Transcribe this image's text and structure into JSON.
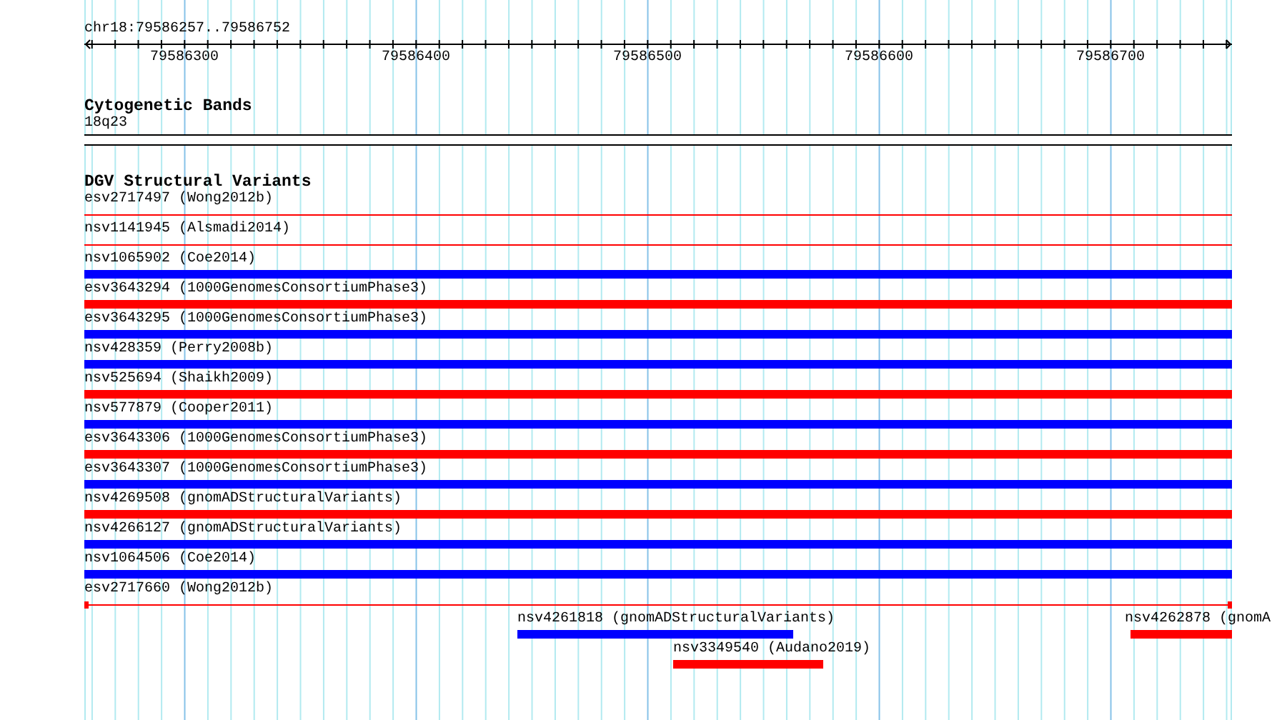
{
  "ruler": {
    "location": "chr18:79586257..79586752",
    "tick_labels": [
      "79586300",
      "79586400",
      "79586500",
      "79586600",
      "79586700"
    ]
  },
  "cytogenetic_bands": {
    "title": "Cytogenetic Bands",
    "band": "18q23"
  },
  "dgv_track": {
    "title": "DGV Structural Variants",
    "features": [
      {
        "label": "esv2717497 (Wong2012b)",
        "color": "#ff0000",
        "kind": "line"
      },
      {
        "label": "nsv1141945 (Alsmadi2014)",
        "color": "#ff0000",
        "kind": "line"
      },
      {
        "label": "nsv1065902 (Coe2014)",
        "color": "#0000ff",
        "kind": "bar"
      },
      {
        "label": "esv3643294 (1000GenomesConsortiumPhase3)",
        "color": "#ff0000",
        "kind": "bar"
      },
      {
        "label": "esv3643295 (1000GenomesConsortiumPhase3)",
        "color": "#0000ff",
        "kind": "bar"
      },
      {
        "label": "nsv428359 (Perry2008b)",
        "color": "#0000ff",
        "kind": "bar"
      },
      {
        "label": "nsv525694 (Shaikh2009)",
        "color": "#ff0000",
        "kind": "bar"
      },
      {
        "label": "nsv577879 (Cooper2011)",
        "color": "#0000ff",
        "kind": "bar"
      },
      {
        "label": "esv3643306 (1000GenomesConsortiumPhase3)",
        "color": "#ff0000",
        "kind": "bar"
      },
      {
        "label": "esv3643307 (1000GenomesConsortiumPhase3)",
        "color": "#0000ff",
        "kind": "bar"
      },
      {
        "label": "nsv4269508 (gnomADStructuralVariants)",
        "color": "#ff0000",
        "kind": "bar"
      },
      {
        "label": "nsv4266127 (gnomADStructuralVariants)",
        "color": "#0000ff",
        "kind": "bar"
      },
      {
        "label": "nsv1064506 (Coe2014)",
        "color": "#0000ff",
        "kind": "bar"
      },
      {
        "label": "esv2717660 (Wong2012b)",
        "color": "#ff0000",
        "kind": "capped-line"
      },
      {
        "label": "nsv4261818 (gnomADStructuralVariants)",
        "color": "#0000ff",
        "kind": "bar"
      },
      {
        "label": "nsv4262878 (gnomA",
        "color": "#ff0000",
        "kind": "bar"
      },
      {
        "label": "nsv3349540 (Audano2019)",
        "color": "#ff0000",
        "kind": "bar"
      }
    ]
  }
}
